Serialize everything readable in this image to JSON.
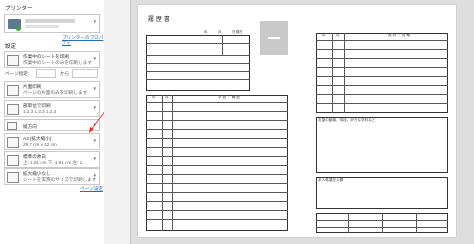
{
  "printer": {
    "heading": "プリンター",
    "properties_link": "プリンターのプロパティ"
  },
  "settings": {
    "heading": "設定",
    "print_range": {
      "title": "作業中のシートを印刷",
      "subtitle": "作業中のシートのみを印刷します"
    },
    "pages": {
      "label": "ページ指定:",
      "to": "から"
    },
    "duplex": {
      "title": "片面印刷",
      "subtitle": "ページの片面のみを印刷します"
    },
    "collate": {
      "title": "部単位で印刷",
      "subtitle": "1,2,3    1,2,3    1,2,3"
    },
    "orientation": {
      "title": "縦方向"
    },
    "paper": {
      "title": "A3 (拡大縮小)",
      "subtitle": "29.7 cm x 42 cm"
    },
    "margins": {
      "title": "標準の余白",
      "subtitle": "上: 1.91 cm 下: 1.91 cm 左: 1..."
    },
    "scaling": {
      "title": "拡大縮小なし",
      "subtitle": "シートを実際のサイズで印刷します"
    },
    "page_setup_link": "ページ設定"
  },
  "preview": {
    "title": "履 歴 書",
    "year_label": "年",
    "month_label": "月",
    "day_label": "日現在",
    "left_header_a": "年",
    "left_header_b": "月",
    "left_header_c": "学 歴 ・ 職 歴",
    "right_header_a": "年",
    "right_header_b": "月",
    "right_header_c": "免 許 ・ 資 格",
    "motivation_label": "志望の動機、特技、好きな学科など",
    "request_label": "本人希望記入欄"
  },
  "colors": {
    "accent": "#2b6cb0",
    "arrow": "#e0302a"
  }
}
